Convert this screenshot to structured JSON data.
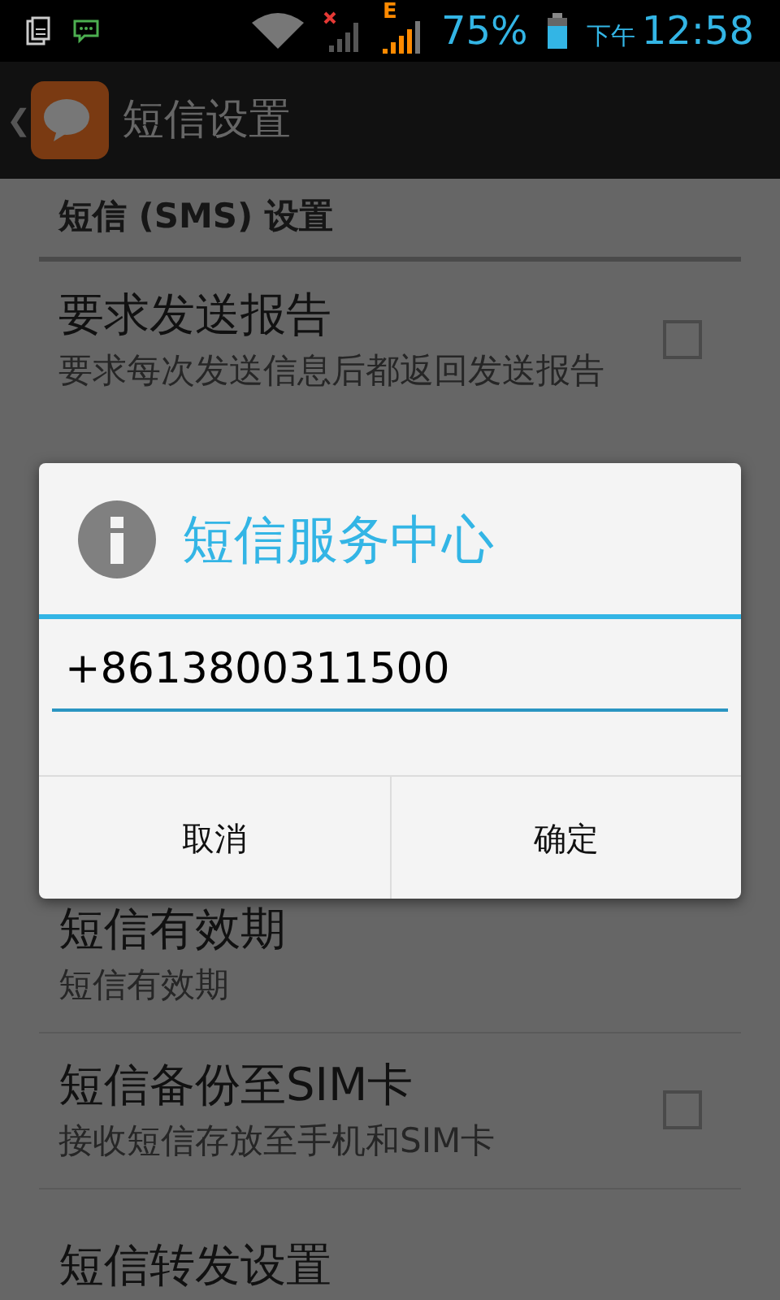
{
  "status_bar": {
    "battery_text": "75%",
    "period": "下午",
    "time": "12:58",
    "network_type": "E"
  },
  "action_bar": {
    "back": "❮",
    "title": "短信设置"
  },
  "section_header": "短信 (SMS) 设置",
  "settings_top": [
    {
      "kind": "checkbox",
      "title": "要求发送报告",
      "summary": "要求每次发送信息后都返回发送报告",
      "checked": false
    }
  ],
  "settings_bottom": [
    {
      "kind": "plain",
      "title": "短信有效期",
      "summary": "短信有效期"
    },
    {
      "kind": "checkbox",
      "title": "短信备份至SIM卡",
      "summary": "接收短信存放至手机和SIM卡",
      "checked": false
    },
    {
      "kind": "plain",
      "title": "短信转发设置"
    }
  ],
  "dialog": {
    "title": "短信服务中心",
    "value": "+8613800311500",
    "buttons": [
      "取消",
      "确定"
    ]
  }
}
